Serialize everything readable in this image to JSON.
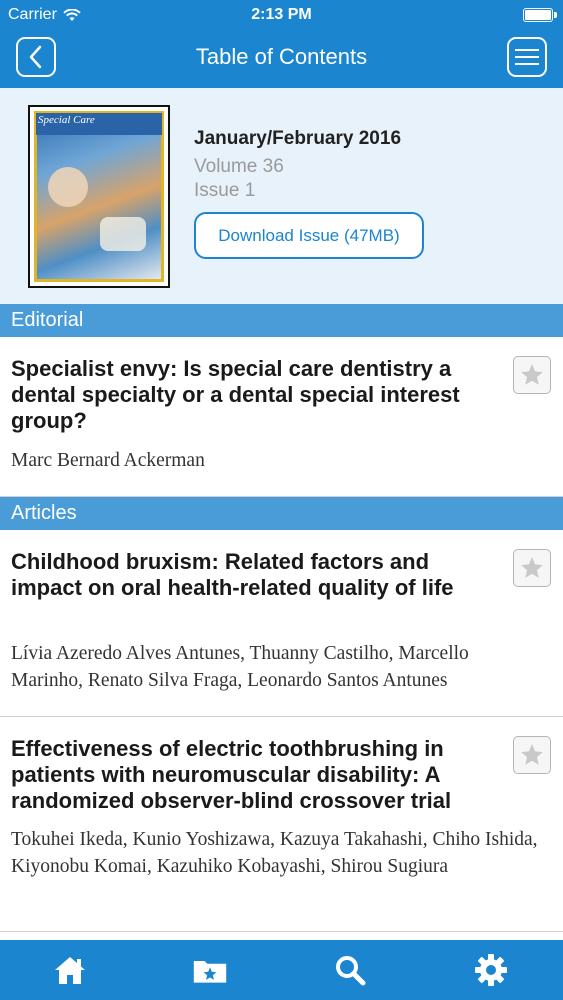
{
  "status_bar": {
    "carrier": "Carrier",
    "time": "2:13 PM",
    "battery_level": 1.0
  },
  "nav": {
    "title": "Table of Contents",
    "back_icon": "chevron-left-icon",
    "menu_icon": "hamburger-icon"
  },
  "issue": {
    "cover_masthead": "Special Care",
    "date": "January/February 2016",
    "volume": "Volume 36",
    "issue": "Issue 1",
    "download_label": "Download Issue (47MB)"
  },
  "sections": [
    {
      "title": "Editorial",
      "articles": [
        {
          "title": "Specialist envy: Is special care dentistry a dental specialty or a dental special interest group?",
          "authors": "Marc Bernard Ackerman"
        }
      ]
    },
    {
      "title": "Articles",
      "articles": [
        {
          "title": "Childhood bruxism: Related factors and impact on oral health-related quality of life",
          "authors": "Lívia Azeredo Alves Antunes, Thuanny Castilho, Marcello Marinho, Renato Silva Fraga, Leonardo Santos Antunes"
        },
        {
          "title": "Effectiveness of electric toothbrushing in patients with neuromuscular disability: A randomized observer-blind crossover trial",
          "authors": "Tokuhei Ikeda, Kunio Yoshizawa, Kazuya Takahashi, Chiho Ishida, Kiyonobu Komai, Kazuhiko Kobayashi, Shirou Sugiura"
        }
      ]
    }
  ],
  "tab_bar": {
    "icons": [
      "home-icon",
      "bookmarks-folder-icon",
      "search-icon",
      "settings-gear-icon"
    ]
  },
  "colors": {
    "primary": "#1b85cf",
    "section_header": "#4a9cd8",
    "issue_bg": "#e8f2fb"
  }
}
